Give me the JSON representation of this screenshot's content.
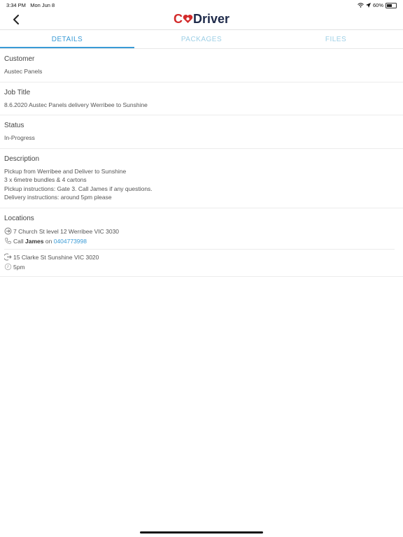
{
  "status_bar": {
    "time": "3:34 PM",
    "date": "Mon Jun 8",
    "battery": "60%"
  },
  "header": {
    "logo_part1": "C",
    "logo_part2": "Driver"
  },
  "tabs": [
    {
      "label": "DETAILS"
    },
    {
      "label": "PACKAGES"
    },
    {
      "label": "FILES"
    }
  ],
  "customer": {
    "label": "Customer",
    "value": "Austec Panels"
  },
  "job_title": {
    "label": "Job Title",
    "value": "8.6.2020 Austec Panels delivery Werribee to Sunshine"
  },
  "status": {
    "label": "Status",
    "value": "In-Progress"
  },
  "description": {
    "label": "Description",
    "lines": [
      "Pickup from Werribee and Deliver to Sunshine",
      "3 x 6metre bundles & 4 cartons",
      "Pickup instructions: Gate 3. Call James if any questions.",
      "Delivery instructions: around 5pm please"
    ]
  },
  "locations": {
    "label": "Locations",
    "pickup": {
      "address": "7 Church St level 12 Werribee VIC 3030",
      "call_prefix": "Call",
      "contact": "James",
      "on": "on",
      "phone": "0404773998"
    },
    "delivery": {
      "address": "15 Clarke St Sunshine VIC 3020",
      "time": "5pm"
    }
  },
  "colors": {
    "accent": "#3a9bd6",
    "brand_red": "#d32b2b",
    "brand_dark": "#1e2a4a"
  }
}
